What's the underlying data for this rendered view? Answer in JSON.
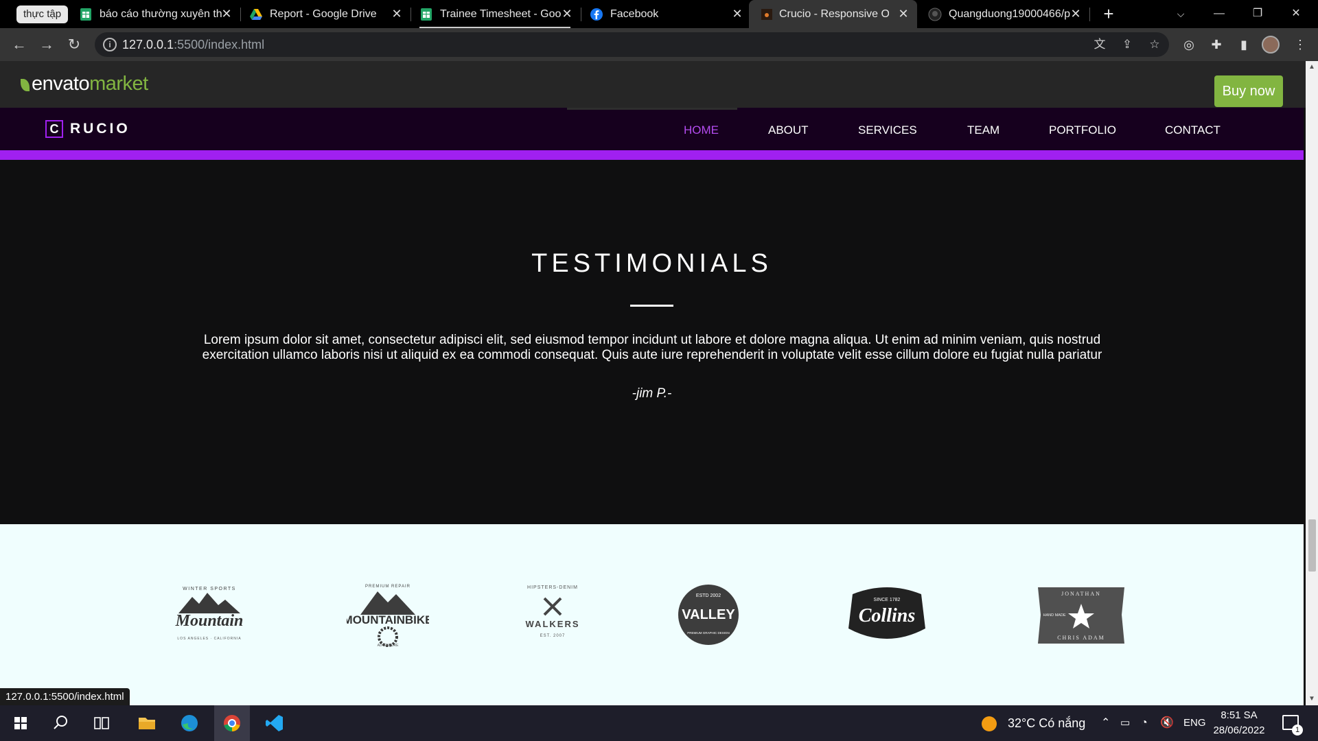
{
  "browser": {
    "tab_group_label": "thực tập",
    "tabs": [
      {
        "title": "báo cáo thường xuyên th",
        "icon": "sheets-icon"
      },
      {
        "title": "Report - Google Drive",
        "icon": "drive-icon"
      },
      {
        "title": "Trainee Timesheet - Goo",
        "icon": "sheets-icon"
      },
      {
        "title": "Facebook",
        "icon": "facebook-icon"
      },
      {
        "title": "Crucio - Responsive One",
        "icon": "crucio-favicon",
        "active": true
      },
      {
        "title": "Quangduong19000466/p",
        "icon": "github-icon"
      }
    ],
    "url_host": "127.0.0.1",
    "url_rest": ":5500/index.html",
    "status_url": "127.0.0.1:5500/index.html"
  },
  "envato": {
    "logo_part1": "envato",
    "logo_part2": "market",
    "buy_now": "Buy now",
    "accent": "#82b541"
  },
  "site": {
    "brand_letter": "C",
    "brand_word": "RUCIO",
    "accent": "#a020f0",
    "nav": [
      {
        "label": "HOME",
        "active": true
      },
      {
        "label": "ABOUT"
      },
      {
        "label": "SERVICES"
      },
      {
        "label": "TEAM"
      },
      {
        "label": "PORTFOLIO"
      },
      {
        "label": "CONTACT"
      }
    ]
  },
  "testimonials": {
    "title": "TESTIMONIALS",
    "quote": "Lorem ipsum dolor sit amet, consectetur adipisci elit, sed eiusmod tempor incidunt ut labore et dolore magna aliqua. Ut enim ad minim veniam, quis nostrud exercitation ullamco laboris nisi ut aliquid ex ea commodi consequat. Quis aute iure reprehenderit in voluptate velit esse cillum dolore eu fugiat nulla pariatur",
    "author": "-jim P.-"
  },
  "clients": [
    {
      "name": "Mountain",
      "top": "WINTER SPORTS",
      "bottom": "LOS ANGELES · CALIFORNIA"
    },
    {
      "name": "MOUNTAINBIKE",
      "top": "PREMIUM REPAIR",
      "bottom": "ADVENTURE"
    },
    {
      "name": "WALKERS",
      "top": "HIPSTERS-DENIM",
      "bottom": "EST. 2007"
    },
    {
      "name": "VALLEY",
      "top": "ESTD 2002",
      "bottom": "PREMIUM GRAPHIC DESIGN"
    },
    {
      "name": "Collins",
      "top": "SINCE 1782",
      "bottom": ""
    },
    {
      "name": "JONATHAN",
      "top": "HAND MADE",
      "bottom": "CHRIS ADAM"
    }
  ],
  "taskbar": {
    "weather": "32°C  Có nắng",
    "lang": "ENG",
    "time": "8:51 SA",
    "date": "28/06/2022",
    "notifications": "1"
  }
}
